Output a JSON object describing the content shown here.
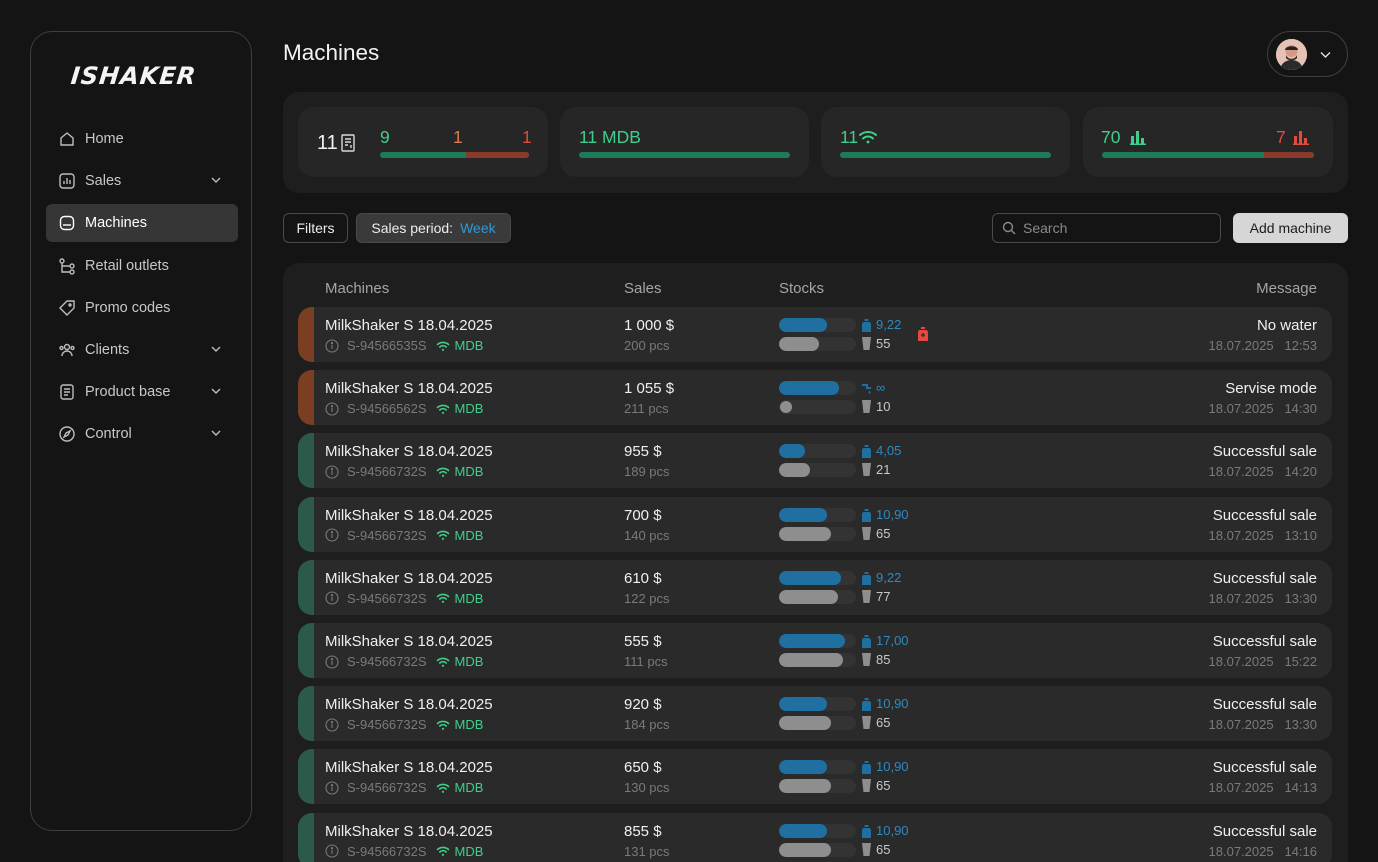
{
  "app": {
    "logo": "ISHAKER",
    "page_title": "Machines"
  },
  "sidebar": {
    "items": [
      {
        "label": "Home",
        "icon": "home-icon"
      },
      {
        "label": "Sales",
        "icon": "chart-icon"
      },
      {
        "label": "Machines",
        "icon": "machine-icon"
      },
      {
        "label": "Retail outlets",
        "icon": "outlets-icon"
      },
      {
        "label": "Promo codes",
        "icon": "tag-icon"
      },
      {
        "label": "Clients",
        "icon": "users-icon"
      },
      {
        "label": "Product base",
        "icon": "document-icon"
      },
      {
        "label": "Control",
        "icon": "compass-icon"
      }
    ]
  },
  "stats": {
    "machines_total": "11",
    "machines_ok": "9",
    "machines_warn": "1",
    "machines_error": "1",
    "mdb": "11 MDB",
    "online": "11",
    "products_ok": "70",
    "products_low": "7"
  },
  "toolbar": {
    "filters_label": "Filters",
    "period_label": "Sales period:",
    "period_value": "Week",
    "search_placeholder": "Search",
    "add_label": "Add machine"
  },
  "table": {
    "headers": {
      "machines": "Machines",
      "sales": "Sales",
      "stocks": "Stocks",
      "message": "Message"
    },
    "mdb_label": "MDB",
    "rows": [
      {
        "name": "MilkShaker S 18.04.2025",
        "serial": "S-94566535S",
        "sales": "1 000 $",
        "pcs": "200 pcs",
        "water": "9,22",
        "water_level": 0.62,
        "cups": "55",
        "cup_level": 0.52,
        "message": "No water",
        "date": "18.07.2025",
        "time": "12:53",
        "status": "warning"
      },
      {
        "name": "MilkShaker S 18.04.2025",
        "serial": "S-94566562S",
        "sales": "1 055 $",
        "pcs": "211 pcs",
        "water": "∞",
        "water_level": 0.78,
        "cups": "10",
        "cup_level": 0.0,
        "message": "Servise mode",
        "date": "18.07.2025",
        "time": "14:30",
        "status": "warning"
      },
      {
        "name": "MilkShaker S 18.04.2025",
        "serial": "S-94566732S",
        "sales": "955 $",
        "pcs": "189 pcs",
        "water": "4,05",
        "water_level": 0.34,
        "cups": "21",
        "cup_level": 0.4,
        "message": "Successful sale",
        "date": "18.07.2025",
        "time": "14:20",
        "status": "ok"
      },
      {
        "name": "MilkShaker S 18.04.2025",
        "serial": "S-94566732S",
        "sales": "700 $",
        "pcs": "140 pcs",
        "water": "10,90",
        "water_level": 0.62,
        "cups": "65",
        "cup_level": 0.67,
        "message": "Successful sale",
        "date": "18.07.2025",
        "time": "13:10",
        "status": "ok"
      },
      {
        "name": "MilkShaker S 18.04.2025",
        "serial": "S-94566732S",
        "sales": "610 $",
        "pcs": "122 pcs",
        "water": "9,22",
        "water_level": 0.8,
        "cups": "77",
        "cup_level": 0.77,
        "message": "Successful sale",
        "date": "18.07.2025",
        "time": "13:30",
        "status": "ok"
      },
      {
        "name": "MilkShaker S 18.04.2025",
        "serial": "S-94566732S",
        "sales": "555 $",
        "pcs": "111 pcs",
        "water": "17,00",
        "water_level": 0.86,
        "cups": "85",
        "cup_level": 0.83,
        "message": "Successful sale",
        "date": "18.07.2025",
        "time": "15:22",
        "status": "ok"
      },
      {
        "name": "MilkShaker S 18.04.2025",
        "serial": "S-94566732S",
        "sales": "920 $",
        "pcs": "184 pcs",
        "water": "10,90",
        "water_level": 0.62,
        "cups": "65",
        "cup_level": 0.67,
        "message": "Successful sale",
        "date": "18.07.2025",
        "time": "13:30",
        "status": "ok"
      },
      {
        "name": "MilkShaker S 18.04.2025",
        "serial": "S-94566732S",
        "sales": "650 $",
        "pcs": "130 pcs",
        "water": "10,90",
        "water_level": 0.62,
        "cups": "65",
        "cup_level": 0.67,
        "message": "Successful sale",
        "date": "18.07.2025",
        "time": "14:13",
        "status": "ok"
      },
      {
        "name": "MilkShaker S 18.04.2025",
        "serial": "S-94566732S",
        "sales": "855 $",
        "pcs": "131 pcs",
        "water": "10,90",
        "water_level": 0.62,
        "cups": "65",
        "cup_level": 0.67,
        "message": "Successful sale",
        "date": "18.07.2025",
        "time": "14:16",
        "status": "ok"
      }
    ]
  },
  "colors": {
    "ok": "#2c5a48",
    "warning": "#7a3f22"
  }
}
